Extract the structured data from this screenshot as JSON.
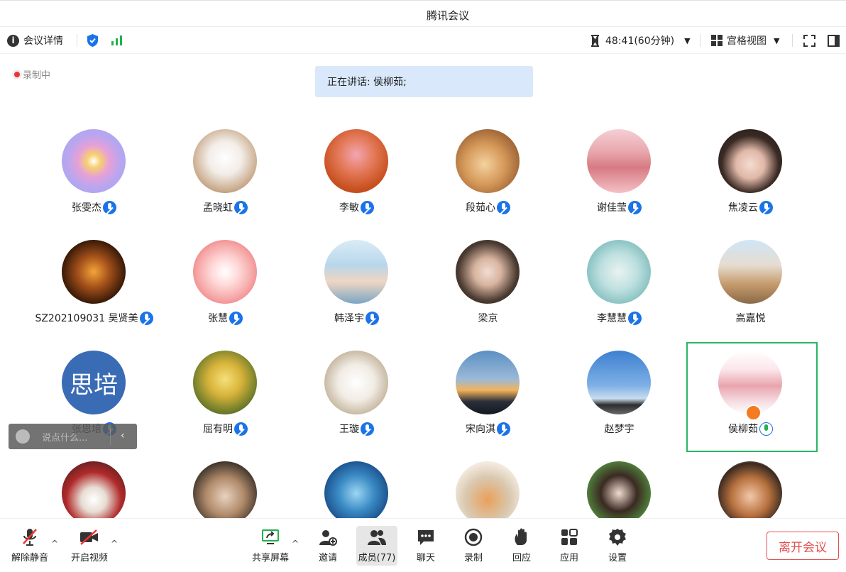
{
  "window": {
    "title": "腾讯会议"
  },
  "toolbar": {
    "meeting_details": "会议详情",
    "timer": "48:41(60分钟)",
    "view_mode": "宫格视图"
  },
  "recording_status": "录制中",
  "speaking": "正在讲话: 侯柳茹;",
  "participants": [
    {
      "name": "张雯杰",
      "mic": "muted",
      "avatar": "purple-glow"
    },
    {
      "name": "孟晓虹",
      "mic": "muted",
      "avatar": "white-cat"
    },
    {
      "name": "李敏",
      "mic": "muted",
      "avatar": "pink-panther"
    },
    {
      "name": "段茹心",
      "mic": "muted",
      "avatar": "kittens"
    },
    {
      "name": "谢佳莹",
      "mic": "muted",
      "avatar": "pink-hotel"
    },
    {
      "name": "焦凌云",
      "mic": "muted",
      "avatar": "girl-portrait"
    },
    {
      "name": "SZ202109031 吴贤美",
      "mic": "muted",
      "avatar": "lanterns"
    },
    {
      "name": "张慧",
      "mic": "muted",
      "avatar": "cartoon-girl"
    },
    {
      "name": "韩泽宇",
      "mic": "muted",
      "avatar": "anime-boy"
    },
    {
      "name": "梁京",
      "mic": "none",
      "avatar": "woman-portrait"
    },
    {
      "name": "李慧慧",
      "mic": "muted",
      "avatar": "chibi-boy"
    },
    {
      "name": "高嘉悦",
      "mic": "none",
      "avatar": "cafe-girl"
    },
    {
      "name": "张思培",
      "mic": "muted",
      "avatar": "text",
      "avatar_text": "思培"
    },
    {
      "name": "屈有明",
      "mic": "muted",
      "avatar": "autumn-trees"
    },
    {
      "name": "王璇",
      "mic": "muted",
      "avatar": "samoyed"
    },
    {
      "name": "宋向淇",
      "mic": "muted",
      "avatar": "sunset-city"
    },
    {
      "name": "赵梦宇",
      "mic": "none",
      "avatar": "jump-silhouette"
    },
    {
      "name": "侯柳茹",
      "mic": "active",
      "avatar": "anime-girl-host"
    },
    {
      "name": "",
      "mic": "none",
      "avatar": "man-with-cat"
    },
    {
      "name": "",
      "mic": "none",
      "avatar": "girl-cap"
    },
    {
      "name": "",
      "mic": "none",
      "avatar": "ocean-diver"
    },
    {
      "name": "",
      "mic": "none",
      "avatar": "dog-and-cat"
    },
    {
      "name": "",
      "mic": "none",
      "avatar": "girl-garden"
    },
    {
      "name": "",
      "mic": "none",
      "avatar": "bearded-man"
    }
  ],
  "chat_input": {
    "placeholder": "说点什么..."
  },
  "bottom_bar": {
    "unmute": "解除静音",
    "start_video": "开启视频",
    "share_screen": "共享屏幕",
    "invite": "邀请",
    "members": "成员(77)",
    "chat": "聊天",
    "record": "录制",
    "react": "回应",
    "apps": "应用",
    "settings": "设置",
    "leave": "离开会议"
  },
  "colors": {
    "accent": "#1a73e8",
    "highlight": "#2bb664",
    "leave": "#e35050",
    "speaking_bg": "#d9e9fb"
  }
}
